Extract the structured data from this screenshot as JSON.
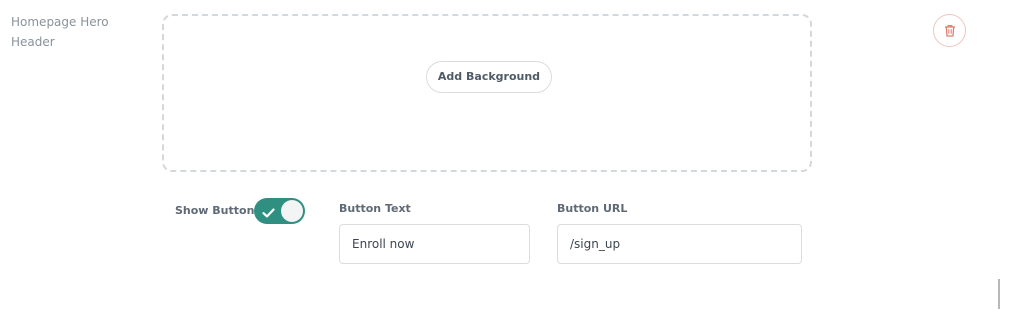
{
  "section": {
    "title": "Homepage Hero Header"
  },
  "background": {
    "add_label": "Add Background"
  },
  "delete": {
    "icon": "trash-icon",
    "color": "#d9826f"
  },
  "show_button": {
    "label": "Show Button",
    "enabled": true,
    "color": "#2f8f80"
  },
  "button_text": {
    "label": "Button Text",
    "value": "Enroll now"
  },
  "button_url": {
    "label": "Button URL",
    "value": "/sign_up"
  }
}
